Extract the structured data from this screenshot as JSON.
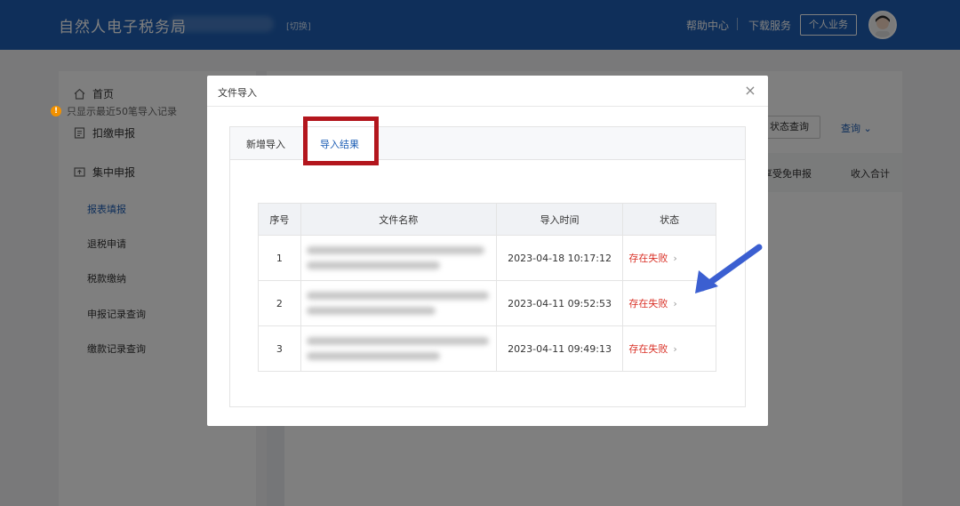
{
  "header": {
    "app_title": "自然人电子税务局",
    "switch_label": "[切换]",
    "help_center": "帮助中心",
    "download_service": "下载服务",
    "personal_business": "个人业务"
  },
  "sidebar": {
    "items": [
      {
        "label": "首页",
        "icon": "home-icon"
      },
      {
        "label": "扣缴申报",
        "icon": "document-icon"
      },
      {
        "label": "集中申报",
        "icon": "upload-icon"
      }
    ],
    "subitems": [
      {
        "label": "报表填报",
        "active": true
      },
      {
        "label": "退税申请",
        "active": false
      },
      {
        "label": "税款缴纳",
        "active": false
      },
      {
        "label": "申报记录查询",
        "active": false
      },
      {
        "label": "缴款记录查询",
        "active": false
      }
    ]
  },
  "background_main": {
    "status_query_button": "状态查询",
    "query_link": "查询",
    "col_exempt": "享受免申报",
    "col_income": "收入合计"
  },
  "dialog": {
    "title": "文件导入",
    "tabs": [
      {
        "label": "新增导入",
        "active": false
      },
      {
        "label": "导入结果",
        "active": true
      }
    ],
    "notice": "只显示最近50笔导入记录",
    "table": {
      "columns": [
        "序号",
        "文件名称",
        "导入时间",
        "状态"
      ],
      "rows": [
        {
          "no": "1",
          "import_time": "2023-04-18 10:17:12",
          "status": "存在失败"
        },
        {
          "no": "2",
          "import_time": "2023-04-11 09:52:53",
          "status": "存在失败"
        },
        {
          "no": "3",
          "import_time": "2023-04-11 09:49:13",
          "status": "存在失败"
        }
      ]
    }
  },
  "colors": {
    "header_blue": "#1e5fb5",
    "highlight_red": "#b3161d",
    "fail_red": "#d93026",
    "warning_orange": "#f29100",
    "arrow_blue": "#3b5fd1"
  }
}
